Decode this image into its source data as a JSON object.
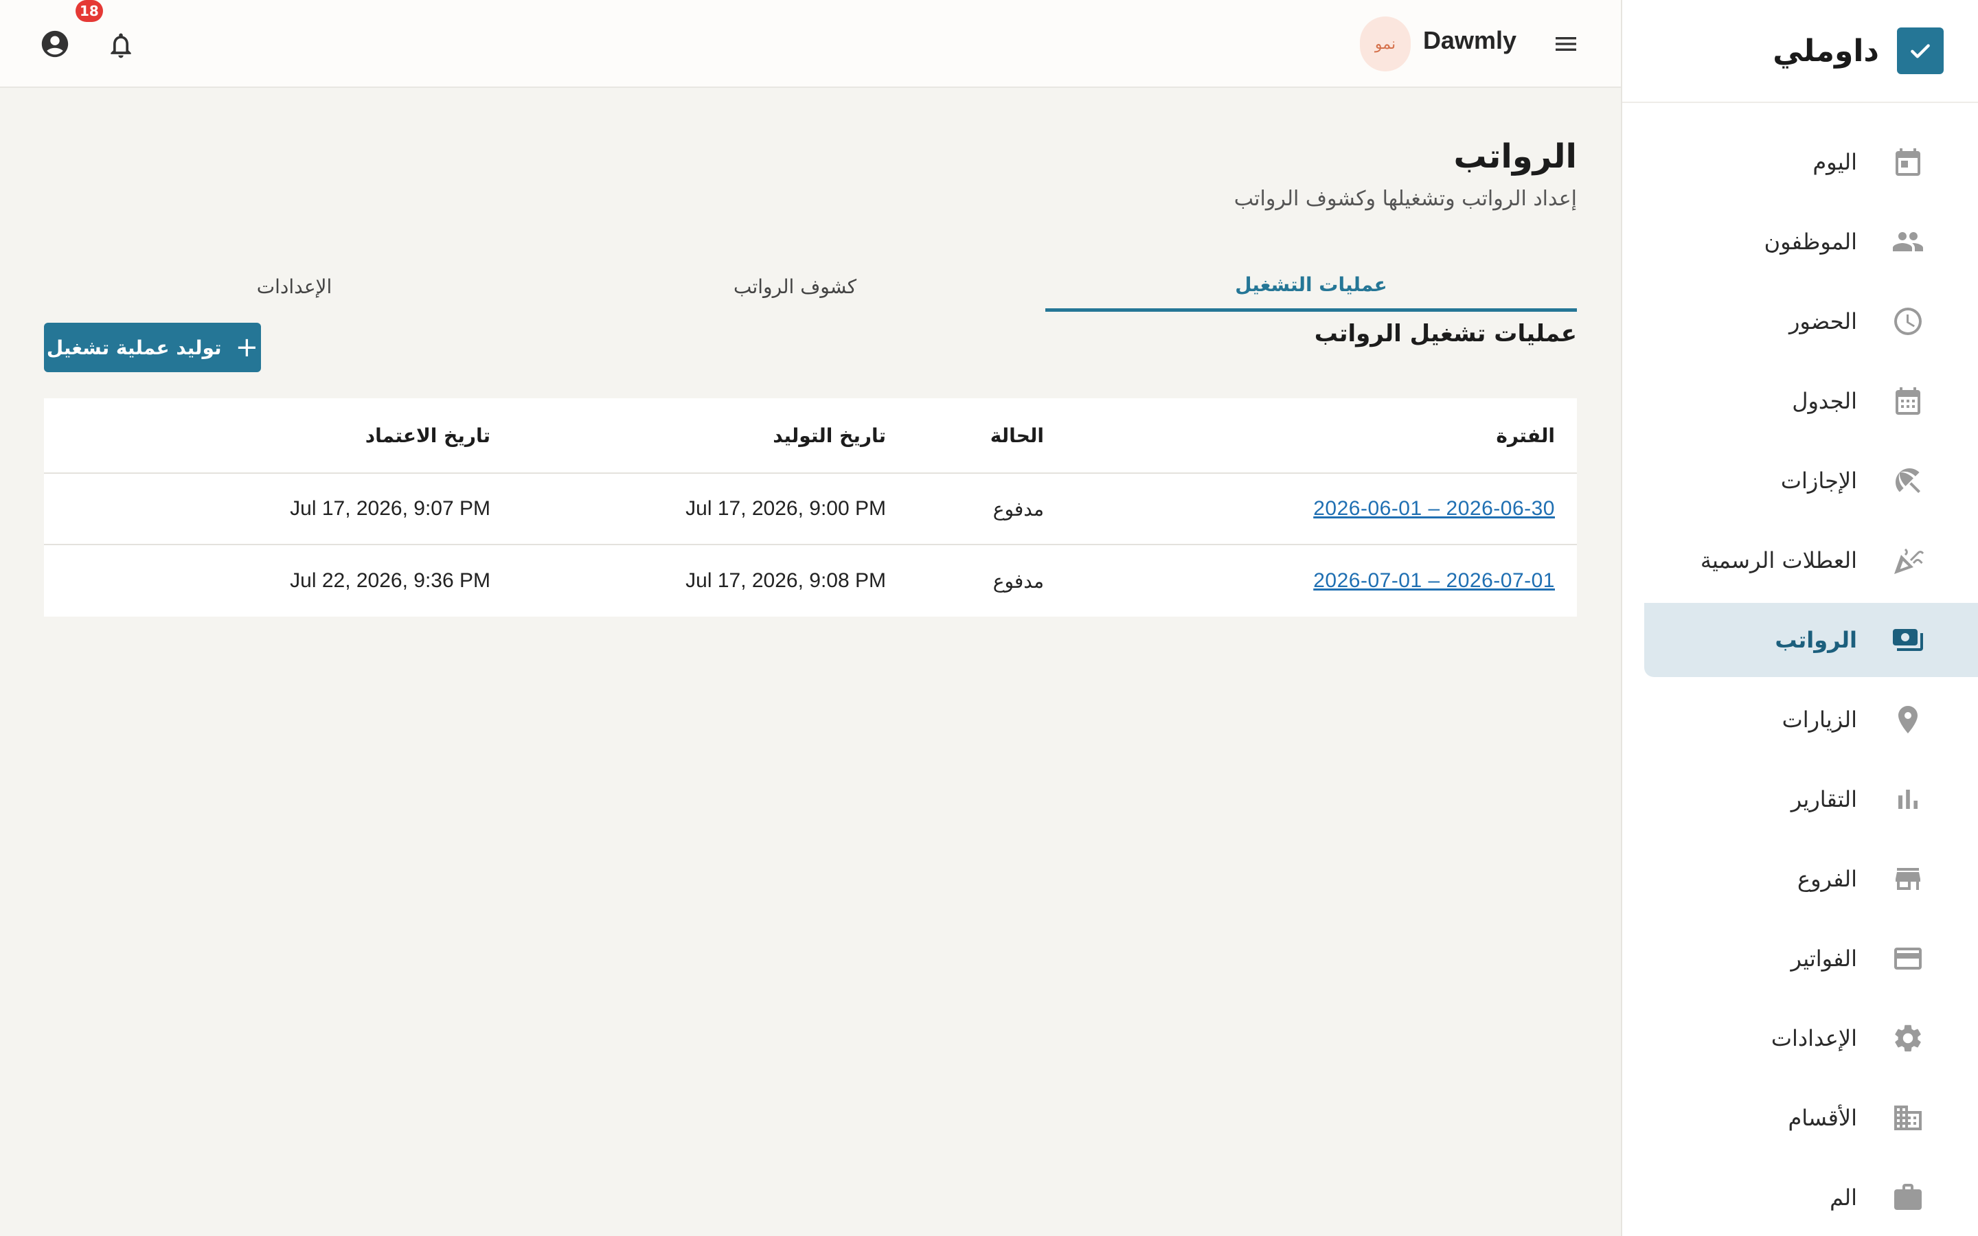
{
  "sidebar": {
    "brand_name": "داوملي",
    "items": [
      {
        "label": "اليوم",
        "icon": "calendar-today-icon"
      },
      {
        "label": "الموظفون",
        "icon": "people-icon"
      },
      {
        "label": "الحضور",
        "icon": "clock-icon"
      },
      {
        "label": "الجدول",
        "icon": "calendar-grid-icon"
      },
      {
        "label": "الإجازات",
        "icon": "beach-umbrella-icon"
      },
      {
        "label": "العطلات الرسمية",
        "icon": "celebration-icon"
      },
      {
        "label": "الرواتب",
        "icon": "payments-icon",
        "active": true
      },
      {
        "label": "الزيارات",
        "icon": "location-pin-icon"
      },
      {
        "label": "التقارير",
        "icon": "bar-chart-icon"
      },
      {
        "label": "الفروع",
        "icon": "store-icon"
      },
      {
        "label": "الفواتير",
        "icon": "credit-card-icon"
      },
      {
        "label": "الإعدادات",
        "icon": "gear-icon"
      },
      {
        "label": "الأقسام",
        "icon": "building-icon"
      },
      {
        "label": "الم",
        "icon": "briefcase-icon"
      }
    ]
  },
  "topbar": {
    "brand": "Dawmly",
    "plan_chip": "نمو",
    "notification_count": "18"
  },
  "page": {
    "title": "الرواتب",
    "subtitle": "إعداد الرواتب وتشغيلها وكشوف الرواتب",
    "tabs": [
      {
        "label": "عمليات التشغيل",
        "active": true
      },
      {
        "label": "كشوف الرواتب"
      },
      {
        "label": "الإعدادات"
      }
    ],
    "section_title": "عمليات تشغيل الرواتب",
    "generate_button": "توليد عملية تشغيل"
  },
  "table": {
    "headers": {
      "period": "الفترة",
      "status": "الحالة",
      "generated": "تاريخ التوليد",
      "approved": "تاريخ الاعتماد"
    },
    "rows": [
      {
        "period": "2026-06-01 – 2026-06-30",
        "status": "مدفوع",
        "generated": "Jul 17, 2026, 9:00 PM",
        "approved": "Jul 17, 2026, 9:07 PM"
      },
      {
        "period": "2026-07-01 – 2026-07-01",
        "status": "مدفوع",
        "generated": "Jul 17, 2026, 9:08 PM",
        "approved": "Jul 22, 2026, 9:36 PM"
      }
    ]
  },
  "colors": {
    "accent": "#257696",
    "active_bg": "#dde8ee",
    "badge": "#e53935",
    "link": "#1f6fb2"
  }
}
